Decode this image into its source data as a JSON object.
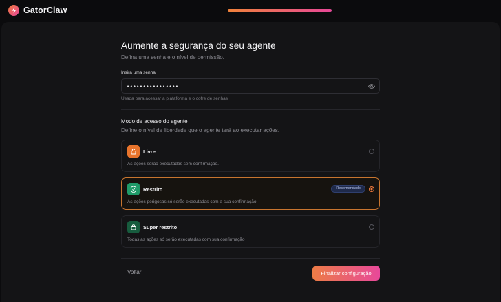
{
  "app": {
    "name": "GatorClaw",
    "logo_icon": "lightning-bolt-icon"
  },
  "progress": {
    "fraction": 1.0
  },
  "page": {
    "title": "Aumente a segurança do seu agente",
    "subtitle": "Defina uma senha e o nível de permissão."
  },
  "password": {
    "label": "Insira uma senha",
    "value": "••••••••••••••••",
    "hint": "Usada para acessar a plataforma e o cofre de senhas",
    "toggle_icon": "eye-icon"
  },
  "access": {
    "title": "Modo de acesso do agente",
    "subtitle": "Define o nível de liberdade que o agente terá ao executar ações.",
    "options": [
      {
        "title": "Livre",
        "description": "As ações serão executadas sem confirmação.",
        "icon": "unlock-icon",
        "color": "#e8742c",
        "selected": false
      },
      {
        "title": "Restrito",
        "description": "As ações perigosas só serão executadas com a sua confirmação.",
        "icon": "shield-check-icon",
        "color": "#1f9a68",
        "selected": true,
        "badge": "Recomendado"
      },
      {
        "title": "Super restrito",
        "description": "Todas as ações só serão executadas com sua confirmação",
        "icon": "lock-icon",
        "color": "#175c3e",
        "selected": false
      }
    ]
  },
  "footer": {
    "back_label": "Voltar",
    "finish_label": "Finalizar configuração"
  },
  "colors": {
    "accent_orange": "#f07a3c",
    "accent_pink": "#e8469a",
    "background": "#0b0b0d",
    "panel": "#141416"
  }
}
